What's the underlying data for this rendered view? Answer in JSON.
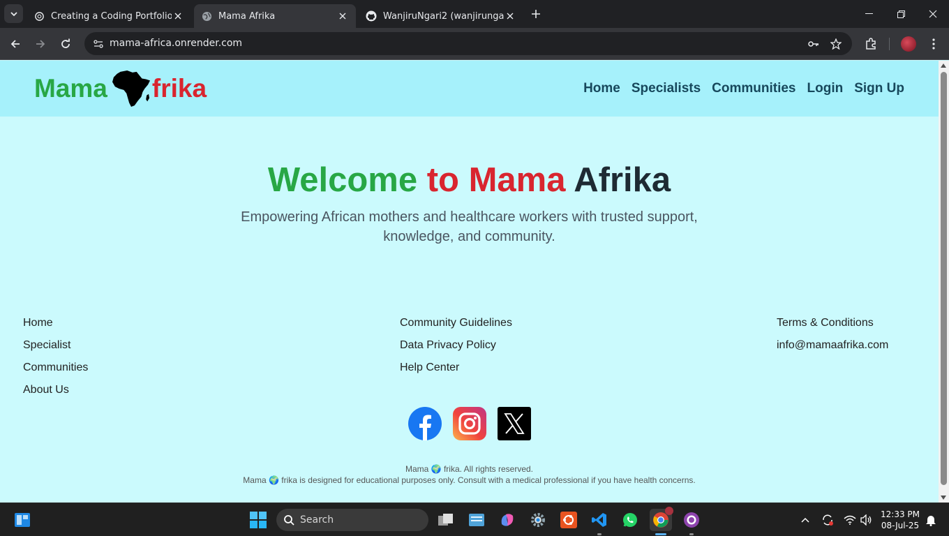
{
  "browser": {
    "tabs": [
      {
        "title": "Creating a Coding Portfolio",
        "favicon": "openai-icon"
      },
      {
        "title": "Mama Afrika",
        "favicon": "globe-icon",
        "active": true
      },
      {
        "title": "WanjiruNgari2 (wanjirungari2)",
        "favicon": "github-icon"
      }
    ],
    "url": "mama-africa.onrender.com"
  },
  "site": {
    "logo": {
      "left": "Mama",
      "right": "frika"
    },
    "nav": [
      "Home",
      "Specialists",
      "Communities",
      "Login",
      "Sign Up"
    ],
    "hero": {
      "title_words": [
        "Welcome",
        "to",
        "Mama",
        "Afrika"
      ],
      "subtitle": "Empowering African mothers and healthcare workers with trusted support, knowledge, and community."
    },
    "footer": {
      "col1": [
        "Home",
        "Specialist",
        "Communities",
        "About Us"
      ],
      "col2": [
        "Community Guidelines",
        "Data Privacy Policy",
        "Help Center"
      ],
      "col3": [
        "Terms & Conditions",
        "info@mamaafrika.com"
      ],
      "social": [
        "facebook-icon",
        "instagram-icon",
        "x-icon"
      ],
      "copyright_left": "Mama",
      "copyright_right": "frika. All rights reserved.",
      "disclaimer_left": "Mama",
      "disclaimer_right": "frika is designed for educational purposes only. Consult with a medical professional if you have health concerns."
    }
  },
  "taskbar": {
    "search_placeholder": "Search",
    "time": "12:33 PM",
    "date": "08-Jul-25"
  },
  "colors": {
    "green": "#28a745",
    "red": "#d9252f",
    "header_bg": "#a6f1fb",
    "page_bg": "#cbfafd",
    "nav_text": "#17485c"
  }
}
